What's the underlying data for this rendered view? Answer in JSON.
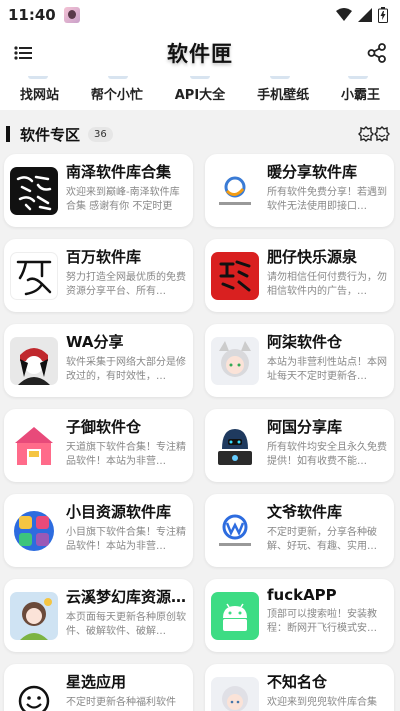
{
  "status": {
    "time": "11:40"
  },
  "app": {
    "title": "软件匣"
  },
  "categories": [
    "找网站",
    "帮个小忙",
    "API大全",
    "手机壁纸",
    "小霸王"
  ],
  "section": {
    "title": "软件专区",
    "count": "36"
  },
  "cards": [
    {
      "name": "南泽软件库合集",
      "desc": "欢迎来到巅峰-南泽软件库合集 感谢有你 不定时更新…",
      "icon": "calligraphy-icon"
    },
    {
      "name": "暖分享软件库",
      "desc": "所有软件免费分享！若遇到软件无法使用即接口…",
      "icon": "logo-icon"
    },
    {
      "name": "百万软件库",
      "desc": "努力打造全网最优质的免费资源分享平台、所有…",
      "icon": "calligraphy-icon"
    },
    {
      "name": "肥仔快乐源泉",
      "desc": "请勿相信任何付费行为，勿相信软件内的广告，…",
      "icon": "seal-icon"
    },
    {
      "name": "WA分享",
      "desc": "软件采集于网络大部分是修改过的，有时效性，…",
      "icon": "avatar-icon"
    },
    {
      "name": "阿柒软件仓",
      "desc": "本站为非营利性站点！本网址每天不定时更新各…",
      "icon": "anime-avatar-icon"
    },
    {
      "name": "子御软件仓",
      "desc": "天道旗下软件合集！专注精品软件！本站为非营…",
      "icon": "store-icon"
    },
    {
      "name": "阿国分享库",
      "desc": "所有软件均安全且永久免费提供！如有收费不能…",
      "icon": "hacker-icon"
    },
    {
      "name": "小目资源软件库",
      "desc": "小目旗下软件合集！专注精品软件！本站为非营…",
      "icon": "apps-icon"
    },
    {
      "name": "文爷软件库",
      "desc": "不定时更新，分享各种破解、好玩、有趣、实用…",
      "icon": "logo-icon"
    },
    {
      "name": "云溪梦幻库资源...",
      "desc": "本页面每天更新各种原创软件、破解软件、破解…",
      "icon": "anime-avatar-icon"
    },
    {
      "name": "fuckAPP",
      "desc": "顶部可以搜索啦！安装教程：断网开飞行模式安…",
      "icon": "android-icon"
    },
    {
      "name": "星选应用",
      "desc": "不定时更新各种福利软件",
      "icon": "smiley-icon"
    },
    {
      "name": "不知名仓",
      "desc": "欢迎来到兜兜软件库合集",
      "icon": "anime-avatar-icon"
    }
  ]
}
